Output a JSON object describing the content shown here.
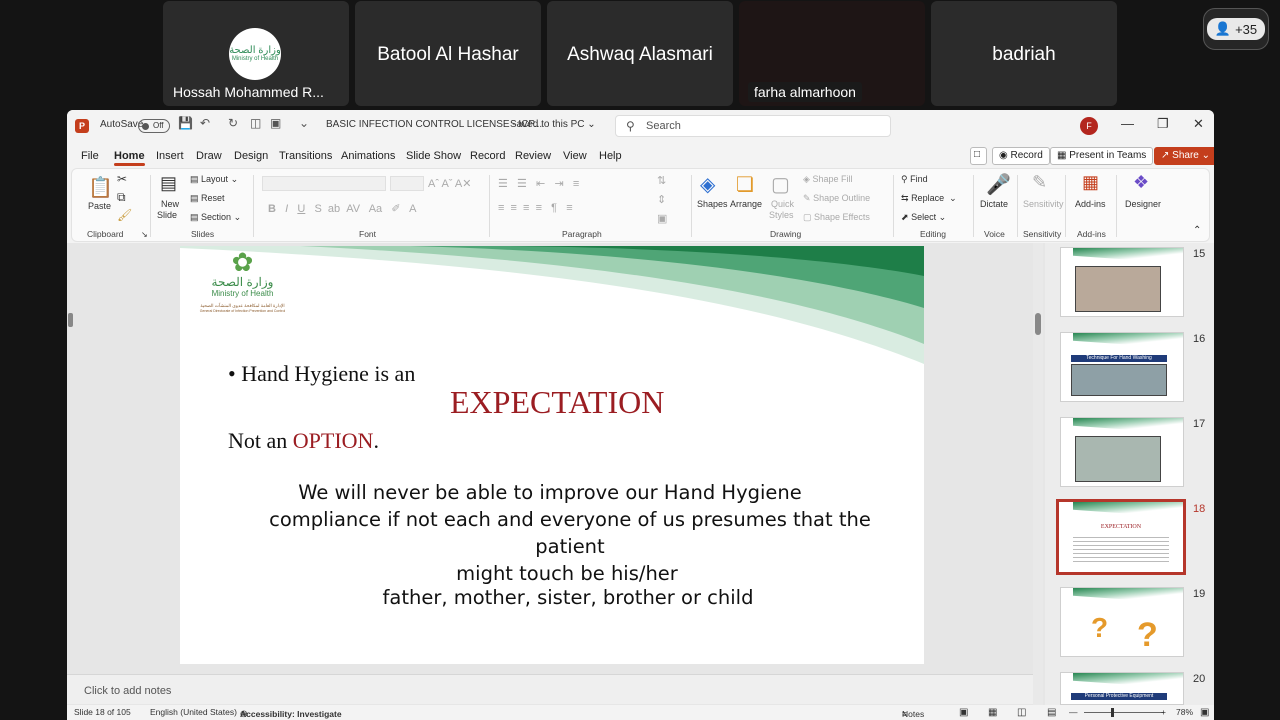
{
  "meeting": {
    "participants": [
      {
        "name": "Hossah Mohammed R...",
        "avatar_line1": "وزارة الصحة",
        "avatar_line2": "Ministry of Health"
      },
      {
        "name": "Batool Al Hashar"
      },
      {
        "name": "Ashwaq Alasmari"
      },
      {
        "name": "farha almarhoon"
      },
      {
        "name": "badriah"
      }
    ],
    "more_count": "+35"
  },
  "titlebar": {
    "autosave_label": "AutoSave",
    "autosave_state": "Off",
    "doc_title": "BASIC INFECTION CONTROL LICENSE - ICP...",
    "save_state": "Saved to this PC",
    "search_placeholder": "Search",
    "user_initial": "F"
  },
  "menu": {
    "items": [
      "File",
      "Home",
      "Insert",
      "Draw",
      "Design",
      "Transitions",
      "Animations",
      "Slide Show",
      "Record",
      "Review",
      "View",
      "Help"
    ],
    "active": "Home",
    "record_button": "Record",
    "present_button": "Present in Teams",
    "share_button": "Share"
  },
  "ribbon": {
    "clipboard": {
      "paste": "Paste",
      "group": "Clipboard"
    },
    "slides": {
      "new_slide_1": "New",
      "new_slide_2": "Slide",
      "layout": "Layout",
      "reset": "Reset",
      "section": "Section",
      "group": "Slides"
    },
    "font": {
      "group": "Font"
    },
    "paragraph": {
      "group": "Paragraph"
    },
    "drawing": {
      "shapes": "Shapes",
      "arrange": "Arrange",
      "quick_1": "Quick",
      "quick_2": "Styles",
      "fill": "Shape Fill",
      "outline": "Shape Outline",
      "effects": "Shape Effects",
      "group": "Drawing"
    },
    "editing": {
      "find": "Find",
      "replace": "Replace",
      "select": "Select",
      "group": "Editing"
    },
    "voice": {
      "dictate": "Dictate",
      "group": "Voice"
    },
    "sensitivity": {
      "label": "Sensitivity",
      "group": "Sensitivity"
    },
    "addins": {
      "label": "Add-ins",
      "group": "Add-ins"
    },
    "designer": {
      "label": "Designer"
    }
  },
  "slide": {
    "logo_ar": "وزارة الصحة",
    "logo_en": "Ministry of Health",
    "logo_sub": "الإدارة العامة لمكافحة عدوى المنشآت الصحية",
    "logo_sub_en": "General Directorate of Infection Prevention and Control",
    "bullet": "Hand Hygiene is an",
    "expectation": "EXPECTATION",
    "not_an": "Not an ",
    "option": "OPTION",
    "period": ".",
    "body_lines": [
      "We will never be able to improve our Hand  Hygiene",
      "compliance if not each and  everyone of us presumes that the",
      "patient",
      "might touch be his/her",
      "father, mother, sister, brother or child"
    ]
  },
  "notes_placeholder": "Click to add notes",
  "thumbnails": [
    {
      "num": "15"
    },
    {
      "num": "16",
      "title": "Technique For Hand Washing"
    },
    {
      "num": "17"
    },
    {
      "num": "18",
      "title": "EXPECTATION",
      "selected": true
    },
    {
      "num": "19"
    },
    {
      "num": "20",
      "title": "Personal Protective Equipment"
    }
  ],
  "status": {
    "slide_pos": "Slide 18 of 105",
    "language": "English (United States)",
    "accessibility": "Accessibility: Investigate",
    "notes": "Notes",
    "zoom": "78%"
  }
}
